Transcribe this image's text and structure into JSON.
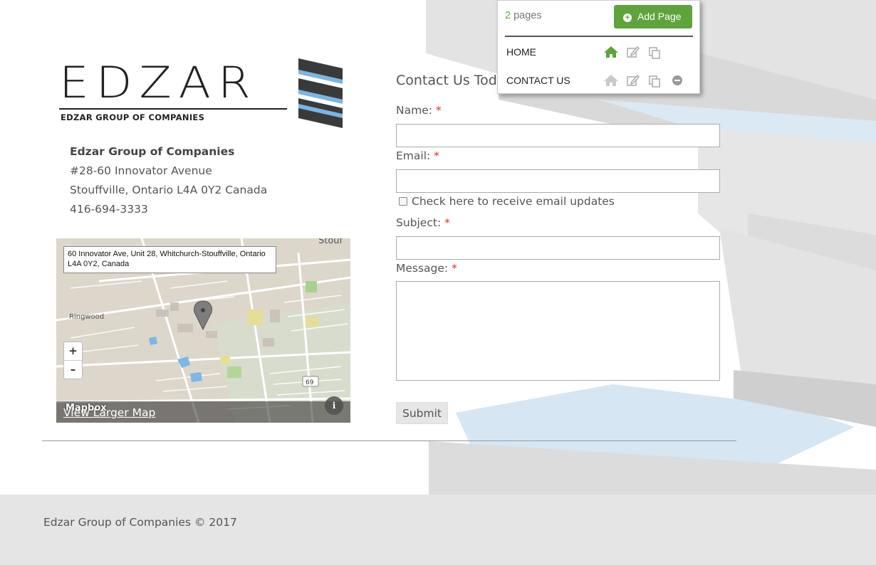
{
  "logo": {
    "name": "EDZAR",
    "tagline": "EDZAR GROUP OF COMPANIES"
  },
  "address": {
    "company": "Edzar Group of Companies",
    "street": "#28-60 Innovator Avenue",
    "city": "Stouffville, Ontario L4A 0Y2 Canada",
    "phone": "416-694-3333"
  },
  "map": {
    "address_popup": "60 Innovator Ave, Unit 28, Whitchurch-Stouffville, Ontario L4A 0Y2, Canada",
    "place_label_1": "Ringwood",
    "place_label_2": "Stouf",
    "road_shield": "69",
    "zoom_in": "+",
    "zoom_out": "–",
    "provider": "Mapbox",
    "view_larger": "View Larger Map",
    "info": "i"
  },
  "form": {
    "title": "Contact Us Tod",
    "name_label": "Name:",
    "email_label": "Email:",
    "required_mark": "*",
    "checkbox_label": "Check here to receive email updates",
    "subject_label": "Subject:",
    "message_label": "Message:",
    "submit_label": "Submit"
  },
  "pages_panel": {
    "count": "2",
    "count_label": "pages",
    "add_page_label": "Add Page",
    "pages": [
      {
        "name": "HOME"
      },
      {
        "name": "CONTACT US"
      }
    ]
  },
  "footer": {
    "copyright": "Edzar Group of Companies © 2017"
  },
  "colors": {
    "accent_green": "#5fa33c",
    "required_red": "#d9302c",
    "water_blue": "#cfe3f2"
  }
}
